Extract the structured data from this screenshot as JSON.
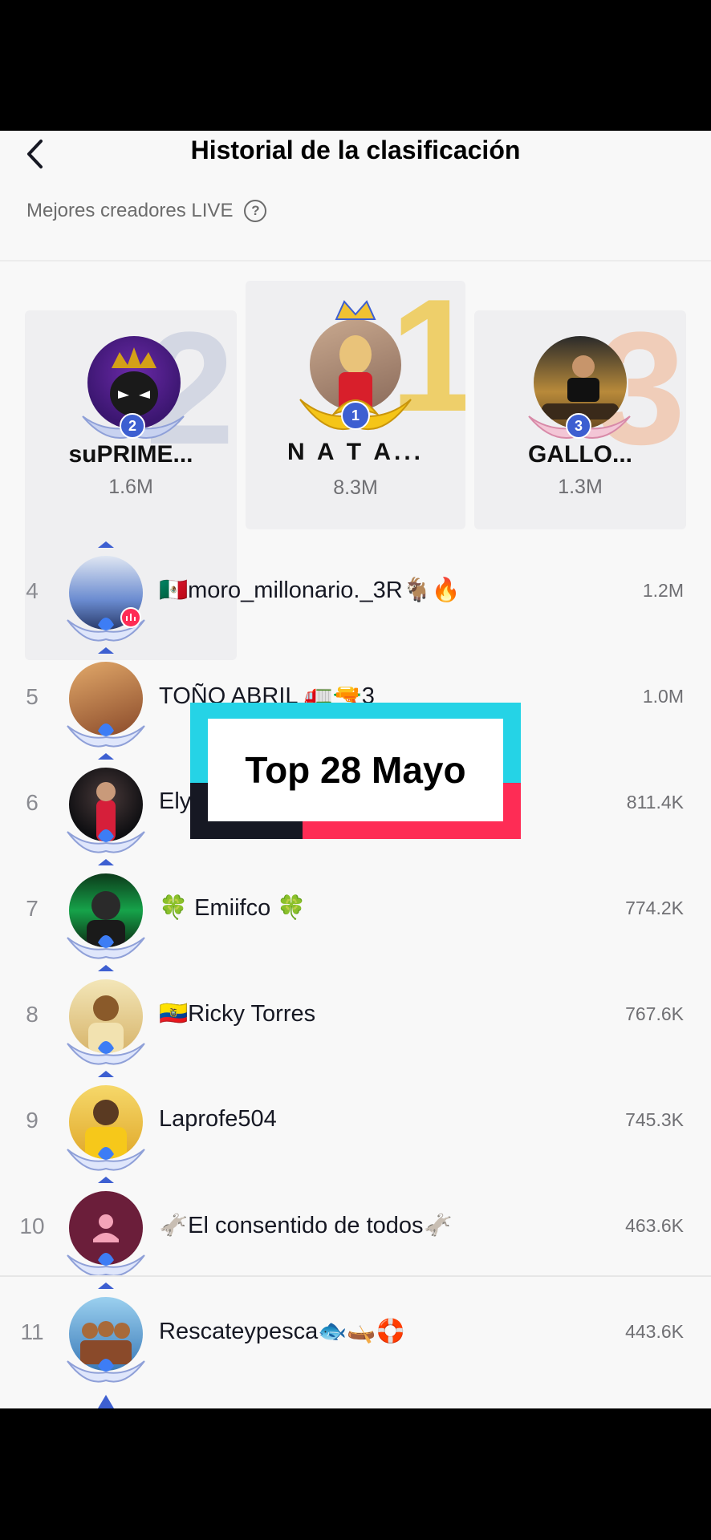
{
  "header": {
    "title": "Historial de la clasificación",
    "subtitle": "Mejores creadores LIVE"
  },
  "podium": [
    {
      "rank": "2",
      "name": "suPRIME...",
      "score": "1.6M"
    },
    {
      "rank": "1",
      "name": "N A T A...",
      "score": "8.3M"
    },
    {
      "rank": "3",
      "name": "GALLO...",
      "score": "1.3M"
    }
  ],
  "list": [
    {
      "rank": "4",
      "name": "🇲🇽moro_millonario._3R🐐🔥",
      "score": "1.2M"
    },
    {
      "rank": "5",
      "name": "TOÑO ABRIL 🚛🔫3",
      "score": "1.0M"
    },
    {
      "rank": "6",
      "name": "Ely",
      "score": "811.4K"
    },
    {
      "rank": "7",
      "name": "🍀 Emiifco 🍀",
      "score": "774.2K"
    },
    {
      "rank": "8",
      "name": "🇪🇨Ricky Torres",
      "score": "767.6K"
    },
    {
      "rank": "9",
      "name": "Laprofe504",
      "score": "745.3K"
    },
    {
      "rank": "10",
      "name": "🫏El consentido de todos🫏",
      "score": "463.6K"
    },
    {
      "rank": "11",
      "name": "Rescateypesca🐟🛶🛟",
      "score": "443.6K"
    }
  ],
  "overlay": {
    "text": "Top 28 Mayo"
  },
  "colors": {
    "gold": "#e6c14a",
    "silver": "#cfd3df",
    "bronze": "#f0c9b4",
    "accent_pink": "#fe2c55",
    "accent_cyan": "#25d3e6"
  }
}
